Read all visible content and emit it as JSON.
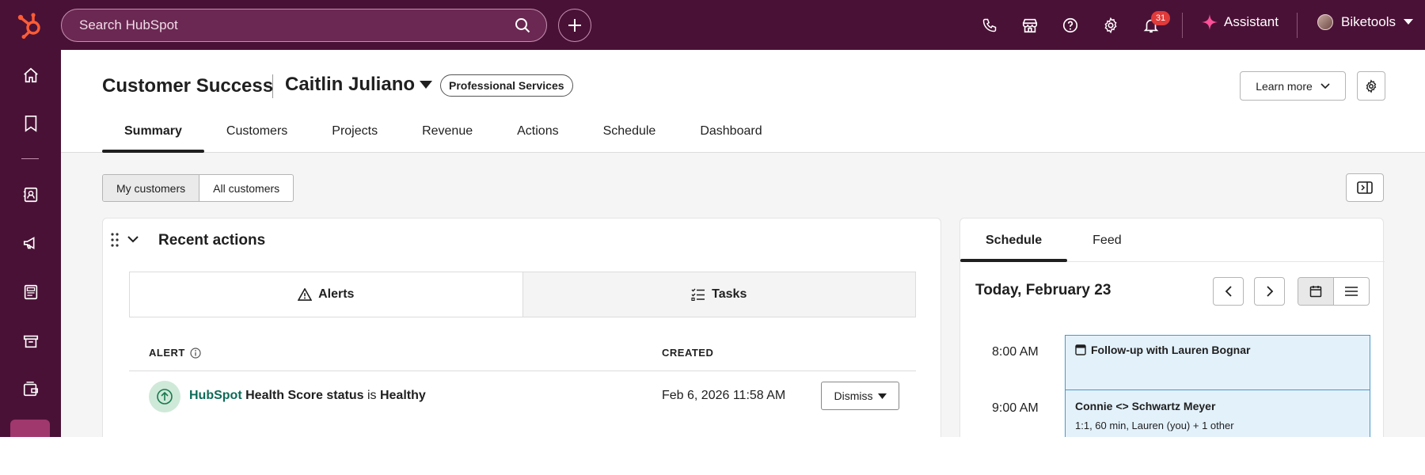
{
  "topbar": {
    "search_placeholder": "Search HubSpot",
    "notifications_count": "31",
    "assistant_label": "Assistant",
    "account_name": "Biketools"
  },
  "sidebar": {
    "items": [
      "home-icon",
      "bookmark-icon",
      "contacts-icon",
      "marketing-icon",
      "content-icon",
      "commerce-icon",
      "automation-icon",
      "service-icon"
    ]
  },
  "header": {
    "title": "Customer Success",
    "user": "Caitlin Juliano",
    "pill": "Professional Services",
    "learn_more": "Learn more",
    "tabs": [
      {
        "label": "Summary",
        "active": true
      },
      {
        "label": "Customers"
      },
      {
        "label": "Projects"
      },
      {
        "label": "Revenue"
      },
      {
        "label": "Actions"
      },
      {
        "label": "Schedule"
      },
      {
        "label": "Dashboard"
      }
    ]
  },
  "filters": {
    "my_customers": "My customers",
    "all_customers": "All customers"
  },
  "recent_actions": {
    "title": "Recent actions",
    "tabs": {
      "alerts": "Alerts",
      "tasks": "Tasks"
    },
    "columns": {
      "alert": "ALERT",
      "created": "CREATED"
    },
    "row": {
      "brand": "HubSpot",
      "subject": "Health Score status",
      "verb": "is",
      "value": "Healthy",
      "created": "Feb 6, 2026 11:58 AM",
      "action": "Dismiss"
    }
  },
  "schedule": {
    "tabs": {
      "schedule": "Schedule",
      "feed": "Feed"
    },
    "day": "Today, February 23",
    "times": [
      "8:00 AM",
      "9:00 AM"
    ],
    "events": [
      {
        "title": "Follow-up with Lauren Bognar"
      },
      {
        "title": "Connie <> Schwartz Meyer",
        "detail": "1:1, 60 min, Lauren (you) + 1 other"
      }
    ]
  },
  "colors": {
    "topbar": "#4a1136",
    "accent_orange": "#ff5c35",
    "assistant_spark": "#ff4f9a",
    "brand_green": "#0d6b58",
    "event_fill": "#e3f1fb",
    "event_border": "#4c98c8"
  }
}
